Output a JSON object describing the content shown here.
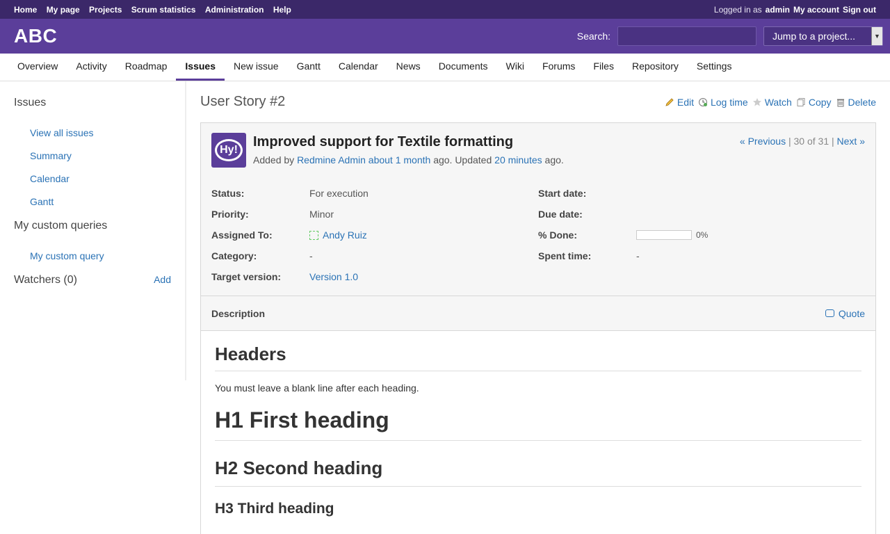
{
  "top_menu": {
    "left": [
      "Home",
      "My page",
      "Projects",
      "Scrum statistics",
      "Administration",
      "Help"
    ],
    "logged_in_as": "Logged in as",
    "user": "admin",
    "my_account": "My account",
    "sign_out": "Sign out"
  },
  "header": {
    "project": "ABC",
    "search_label": "Search:",
    "jump_placeholder": "Jump to a project..."
  },
  "tabs": [
    "Overview",
    "Activity",
    "Roadmap",
    "Issues",
    "New issue",
    "Gantt",
    "Calendar",
    "News",
    "Documents",
    "Wiki",
    "Forums",
    "Files",
    "Repository",
    "Settings"
  ],
  "selected_tab": "Issues",
  "sidebar": {
    "issues_title": "Issues",
    "issue_links": [
      "View all issues",
      "Summary",
      "Calendar",
      "Gantt"
    ],
    "queries_title": "My custom queries",
    "query_links": [
      "My custom query"
    ],
    "watchers_title": "Watchers (0)",
    "watchers_add": "Add"
  },
  "issue": {
    "heading": "User Story #2",
    "actions": {
      "edit": "Edit",
      "log_time": "Log time",
      "watch": "Watch",
      "copy": "Copy",
      "delete": "Delete"
    },
    "avatar_text": "Hy!",
    "subject": "Improved support for Textile formatting",
    "added_by": "Added by",
    "author": "Redmine Admin",
    "created": "about 1 month",
    "ago_updated": "ago. Updated",
    "updated": "20 minutes",
    "ago": "ago.",
    "prev": "« Previous",
    "position": "30 of 31",
    "next": "Next »",
    "attributes_left": [
      {
        "label": "Status:",
        "value": "For execution"
      },
      {
        "label": "Priority:",
        "value": "Minor"
      },
      {
        "label": "Assigned To:",
        "value": "Andy Ruiz"
      },
      {
        "label": "Category:",
        "value": "-"
      },
      {
        "label": "Target version:",
        "value": "Version 1.0"
      }
    ],
    "attributes_right": [
      {
        "label": "Start date:",
        "value": ""
      },
      {
        "label": "Due date:",
        "value": ""
      },
      {
        "label": "% Done:",
        "value": "0%"
      },
      {
        "label": "Spent time:",
        "value": "-"
      }
    ],
    "done_ratio": 0,
    "description_title": "Description",
    "quote": "Quote",
    "description": {
      "headers_title": "Headers",
      "headers_note": "You must leave a blank line after each heading.",
      "h1": "H1 First heading",
      "h2": "H2 Second heading",
      "h3": "H3 Third heading"
    }
  }
}
